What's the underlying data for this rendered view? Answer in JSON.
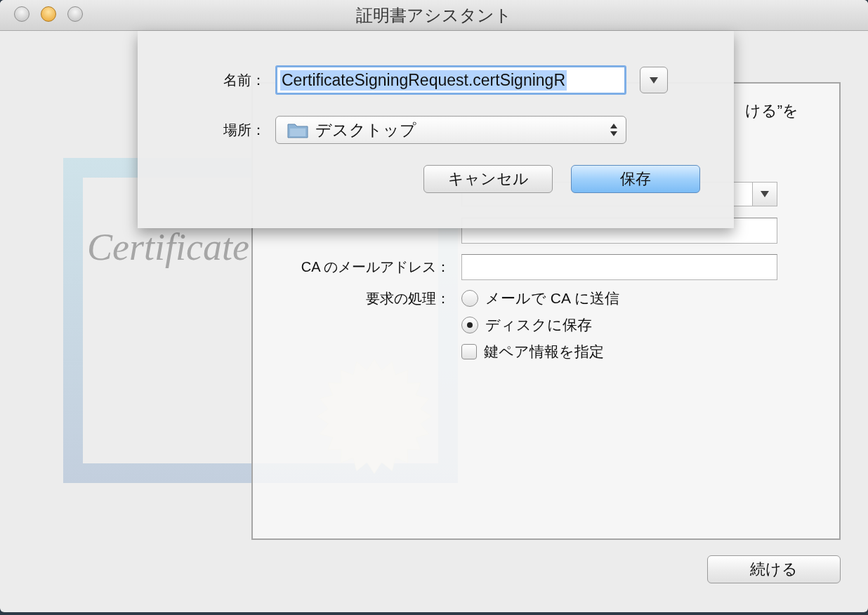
{
  "window": {
    "title": "証明書アシスタント"
  },
  "certificate_art": {
    "title": "Certificate"
  },
  "assistant": {
    "intro_fragment": "ける”を",
    "form_rows": [
      {
        "kind": "popup"
      },
      {
        "kind": "text"
      },
      {
        "kind": "text",
        "label": "CA のメールアドレス："
      }
    ],
    "request": {
      "label": "要求の処理：",
      "options": [
        {
          "label": "メールで CA に送信",
          "selected": false
        },
        {
          "label": "ディスクに保存",
          "selected": true
        }
      ]
    },
    "key_pair": {
      "label": "鍵ペア情報を指定",
      "checked": false
    },
    "continue_button": "続ける"
  },
  "save_sheet": {
    "name_label": "名前：",
    "name_value": "CertificateSigningRequest.certSigningR",
    "name_text_selected": true,
    "location_label": "場所：",
    "location_value": "デスクトップ",
    "buttons": [
      {
        "label": "キャンセル",
        "default": false
      },
      {
        "label": "保存",
        "default": true
      }
    ]
  }
}
